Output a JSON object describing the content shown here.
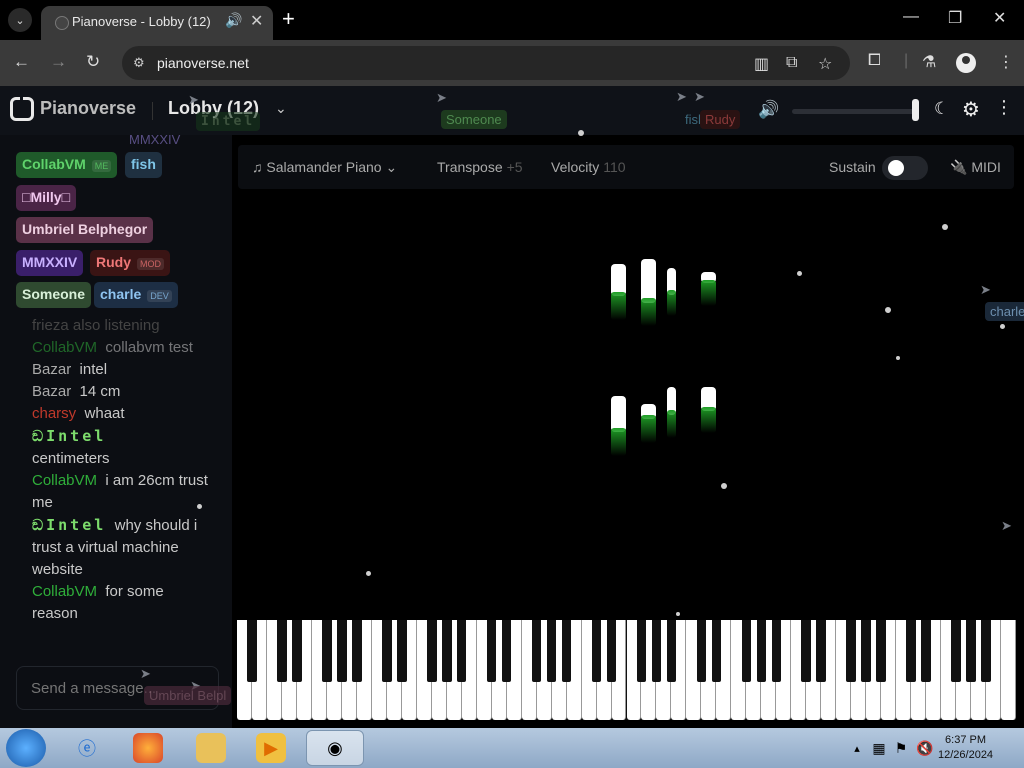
{
  "browser": {
    "tab_title": "Pianoverse - Lobby (12)",
    "url": "pianoverse.net"
  },
  "header": {
    "logo": "Pianoverse",
    "room": "Lobby (12)"
  },
  "users": [
    {
      "name": "CollabVM",
      "tag": "ME",
      "color": "#1f5a2a",
      "fg": "#5fd36b"
    },
    {
      "name": "fish",
      "tag": "",
      "color": "#1f3040",
      "fg": "#7fc6e8"
    },
    {
      "name": "□Milly□",
      "tag": "",
      "color": "#4a2446",
      "fg": "#f0c8ee"
    },
    {
      "name": "Umbriel Belphegor",
      "tag": "",
      "color": "#5a3148",
      "fg": "#eed0e0"
    },
    {
      "name": "MMXXIV",
      "tag": "",
      "color": "#3a1f6a",
      "fg": "#c8b0ff"
    },
    {
      "name": "Rudy",
      "tag": "MOD",
      "color": "#3a1414",
      "fg": "#e77"
    },
    {
      "name": "Someone",
      "tag": "",
      "color": "#2f4a30",
      "fg": "#d8f0d8"
    },
    {
      "name": "charle",
      "tag": "DEV",
      "color": "#1d2e44",
      "fg": "#8fc4f0"
    }
  ],
  "chat": {
    "faded_line": "frieza also listening",
    "m1_user": "CollabVM",
    "m1_text": "collabvm test",
    "m2_user": "Bazar",
    "m2_text": "intel",
    "m3_user": "Bazar",
    "m3_text": "14 cm",
    "m4_user": "charsy",
    "m4_text": "whaat",
    "m5_user": "Intel",
    "m5_text": "centimeters",
    "m6_user": "CollabVM",
    "m6_text": "i am 26cm trust me",
    "m7_user": "Intel",
    "m7_text": "why should i trust a virtual machine website",
    "m8_user": "CollabVM",
    "m8_text": "for some reason",
    "input_placeholder": "Send a message..."
  },
  "controls": {
    "instrument": "Salamander Piano",
    "transpose_label": "Transpose",
    "transpose_value": "+5",
    "velocity_label": "Velocity",
    "velocity_value": "110",
    "sustain_label": "Sustain",
    "midi_label": "MIDI",
    "sustain_on": false
  },
  "cursors": {
    "mmxxiv": "MMXXIV",
    "intel": "Intel",
    "someone": "Someone",
    "fish": "fish",
    "rudy": "Rudy",
    "charle": "charle",
    "umbriel": "Umbriel Belpl"
  },
  "taskbar": {
    "time": "6:37 PM",
    "date": "12/26/2024"
  }
}
